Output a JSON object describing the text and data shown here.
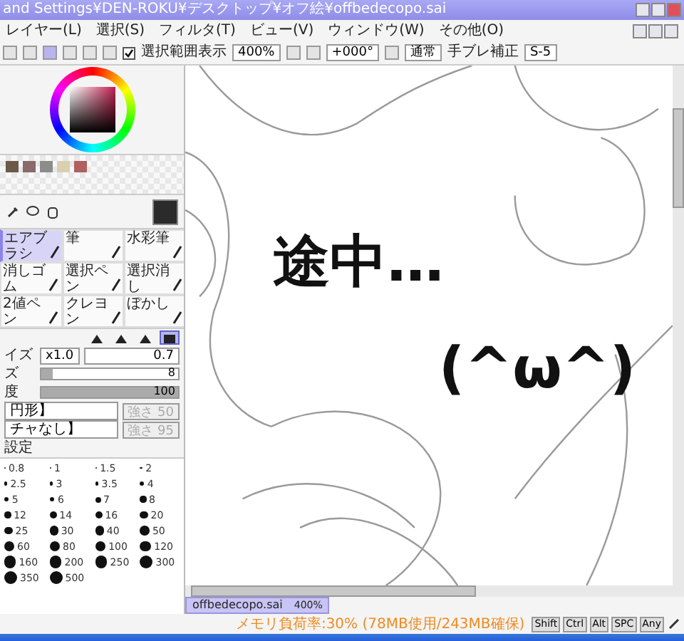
{
  "window": {
    "title": "and Settings¥DEN-ROKU¥デスクトップ¥オフ絵¥offbedecopo.sai"
  },
  "menu": [
    "レイヤー(L)",
    "選択(S)",
    "フィルタ(T)",
    "ビュー(V)",
    "ウィンドウ(W)",
    "その他(O)"
  ],
  "toolbar": {
    "show_selection": {
      "label": "選択範囲表示",
      "checked": true
    },
    "zoom": "400%",
    "rotation": "+000°",
    "blend_mode": "通常",
    "stabilizer_label": "手ブレ補正",
    "stabilizer": "S-5"
  },
  "swatches": [
    {
      "color": "#6b5a4a"
    },
    {
      "color": "#8a6a6a"
    },
    {
      "color": "#8c8c8c"
    },
    {
      "color": "#d8d0b0"
    },
    {
      "color": "#b06060"
    }
  ],
  "tools": [
    {
      "name": "エアブラシ",
      "selected": true
    },
    {
      "name": "筆",
      "selected": false
    },
    {
      "name": "水彩筆",
      "selected": false
    },
    {
      "name": "消しゴム",
      "selected": false
    },
    {
      "name": "選択ペン",
      "selected": false
    },
    {
      "name": "選択消し",
      "selected": false
    },
    {
      "name": "2値ペン",
      "selected": false
    },
    {
      "name": "クレヨン",
      "selected": false
    },
    {
      "name": "ぼかし",
      "selected": false
    }
  ],
  "tip_shapes": [
    {
      "selected": false
    },
    {
      "selected": false
    },
    {
      "selected": false
    },
    {
      "selected": true
    }
  ],
  "params": [
    {
      "kind": "field",
      "label": "イズ",
      "multiplier": "x1.0",
      "value": "0.7"
    },
    {
      "kind": "slider",
      "label": "ズ",
      "value": "8",
      "level": 0.08
    },
    {
      "kind": "slider",
      "label": "度",
      "value": "100",
      "level": 1
    }
  ],
  "textures": [
    {
      "value": "円形】",
      "strength_label": "強さ",
      "strength": "50",
      "disabled": true
    },
    {
      "value": "チャなし】",
      "strength_label": "強さ",
      "strength": "95",
      "disabled": true
    }
  ],
  "settings_label": "設定",
  "sizes": [
    "0.8",
    "1",
    "1.5",
    "2",
    "2.5",
    "3",
    "3.5",
    "4",
    "5",
    "6",
    "7",
    "8",
    "12",
    "14",
    "16",
    "20",
    "25",
    "30",
    "40",
    "50",
    "60",
    "80",
    "100",
    "120",
    "160",
    "200",
    "250",
    "300",
    "350",
    "500"
  ],
  "canvas": {
    "handwriting": [
      "途中…",
      "(^ω^)"
    ]
  },
  "file_tab": {
    "name": "offbedecopo.sai",
    "zoom": "400%",
    "selected": true
  },
  "status": {
    "memory": "メモリ負荷率:30% (78MB使用/243MB確保)",
    "keys": [
      "Shift",
      "Ctrl",
      "Alt",
      "SPC",
      "Any"
    ]
  }
}
